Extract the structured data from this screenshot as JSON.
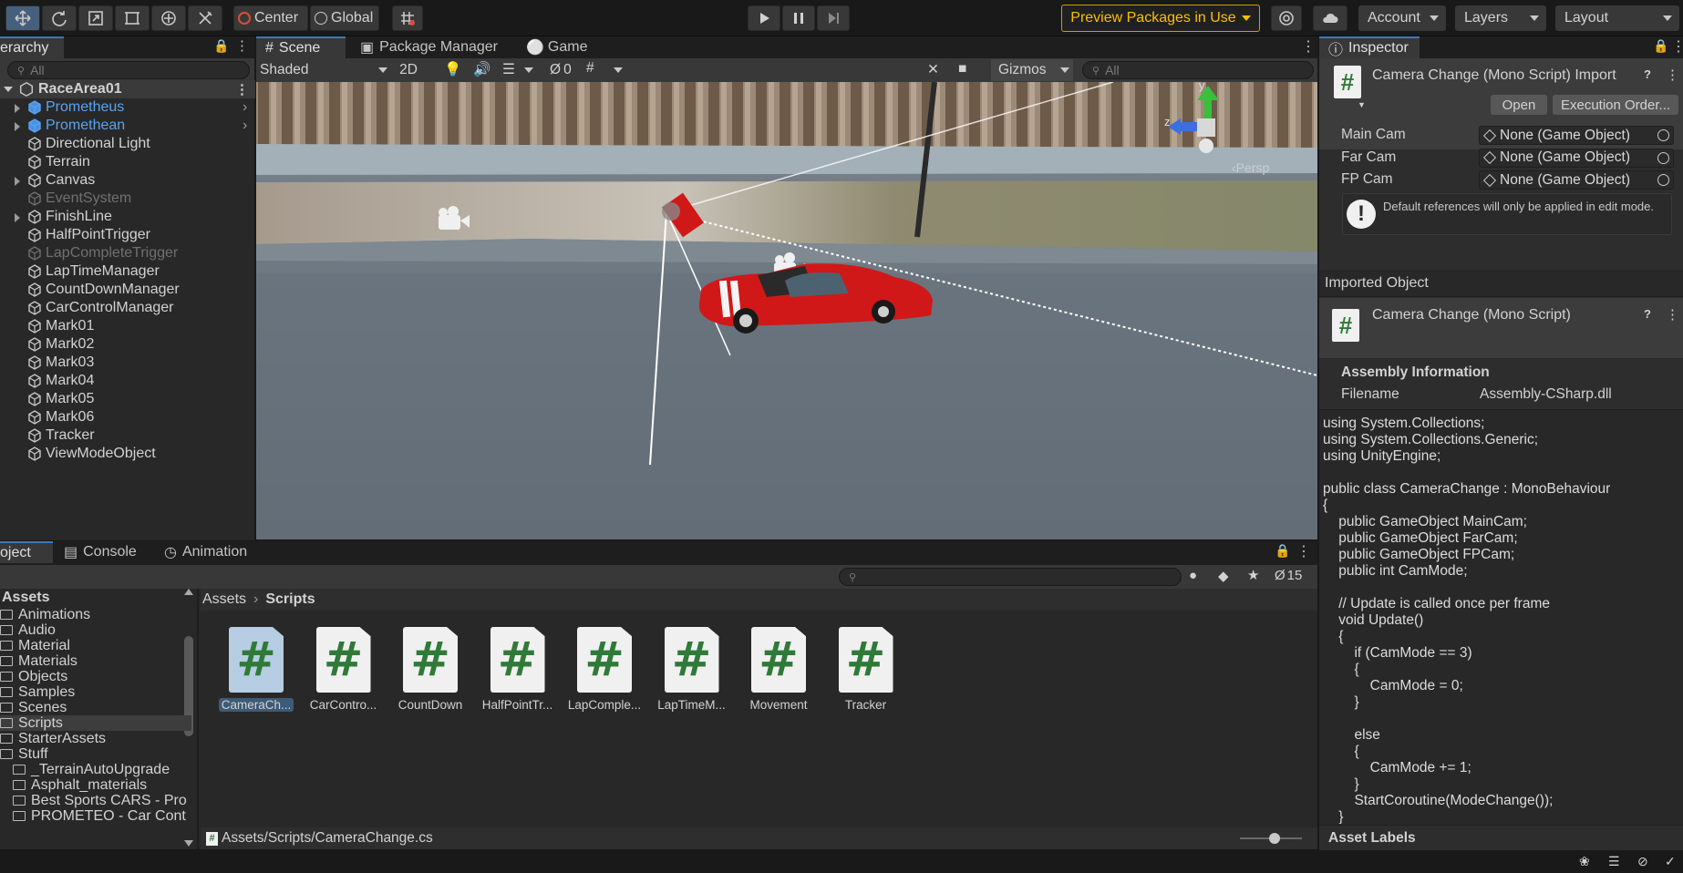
{
  "toolbar": {
    "pivot_label": "Center",
    "space_label": "Global",
    "preview_packages": "Preview Packages in Use",
    "account": "Account",
    "layers": "Layers",
    "layout": "Layout"
  },
  "hierarchy": {
    "tab": "erarchy",
    "search_placeholder": "All",
    "scene_name": "RaceArea01",
    "items": [
      {
        "label": "Prometheus",
        "style": "blue",
        "expand": true
      },
      {
        "label": "Promethean",
        "style": "blue",
        "expand": true
      },
      {
        "label": "Directional Light",
        "style": "normal",
        "expand": false
      },
      {
        "label": "Terrain",
        "style": "normal",
        "expand": false
      },
      {
        "label": "Canvas",
        "style": "normal",
        "expand": true
      },
      {
        "label": "EventSystem",
        "style": "dim",
        "expand": false
      },
      {
        "label": "FinishLine",
        "style": "normal",
        "expand": true
      },
      {
        "label": "HalfPointTrigger",
        "style": "normal",
        "expand": false
      },
      {
        "label": "LapCompleteTrigger",
        "style": "dim",
        "expand": false
      },
      {
        "label": "LapTimeManager",
        "style": "normal",
        "expand": false
      },
      {
        "label": "CountDownManager",
        "style": "normal",
        "expand": false
      },
      {
        "label": "CarControlManager",
        "style": "normal",
        "expand": false
      },
      {
        "label": "Mark01",
        "style": "normal",
        "expand": false
      },
      {
        "label": "Mark02",
        "style": "normal",
        "expand": false
      },
      {
        "label": "Mark03",
        "style": "normal",
        "expand": false
      },
      {
        "label": "Mark04",
        "style": "normal",
        "expand": false
      },
      {
        "label": "Mark05",
        "style": "normal",
        "expand": false
      },
      {
        "label": "Mark06",
        "style": "normal",
        "expand": false
      },
      {
        "label": "Tracker",
        "style": "normal",
        "expand": false
      },
      {
        "label": "ViewModeObject",
        "style": "normal",
        "expand": false
      }
    ]
  },
  "scene": {
    "tabs": [
      "Scene",
      "Package Manager",
      "Game"
    ],
    "shading_mode": "Shaded",
    "mode_2d": "2D",
    "hidden_count": "0",
    "gizmos": "Gizmos",
    "search_placeholder": "All",
    "persp_label": "Persp",
    "axis_y": "y",
    "axis_z": "z"
  },
  "project": {
    "tabs": [
      "oject",
      "Console",
      "Animation"
    ],
    "hidden_count": "15",
    "breadcrumb_root": "Assets",
    "breadcrumb_current": "Scripts",
    "tree_root": "Assets",
    "folders": [
      {
        "label": "Animations",
        "indent": 0
      },
      {
        "label": "Audio",
        "indent": 0
      },
      {
        "label": "Material",
        "indent": 0
      },
      {
        "label": "Materials",
        "indent": 0
      },
      {
        "label": "Objects",
        "indent": 0
      },
      {
        "label": "Samples",
        "indent": 0
      },
      {
        "label": "Scenes",
        "indent": 0
      },
      {
        "label": "Scripts",
        "indent": 0,
        "selected": true
      },
      {
        "label": "StarterAssets",
        "indent": 0
      },
      {
        "label": "Stuff",
        "indent": 0
      },
      {
        "label": "_TerrainAutoUpgrade",
        "indent": 1
      },
      {
        "label": "Asphalt_materials",
        "indent": 1
      },
      {
        "label": "Best Sports CARS - Pro",
        "indent": 1
      },
      {
        "label": "PROMETEO - Car Cont",
        "indent": 1
      }
    ],
    "scripts": [
      "CameraCh...",
      "CarContro...",
      "CountDown",
      "HalfPointTr...",
      "LapComple...",
      "LapTimeM...",
      "Movement",
      "Tracker"
    ],
    "selected_path": "Assets/Scripts/CameraChange.cs",
    "script_glyph": "#"
  },
  "inspector": {
    "tab": "Inspector",
    "title": "Camera Change (Mono Script) Import",
    "open_button": "Open",
    "exec_order_button": "Execution Order...",
    "fields": [
      {
        "label": "Main Cam",
        "value": "None (Game Object)"
      },
      {
        "label": "Far Cam",
        "value": "None (Game Object)"
      },
      {
        "label": "FP Cam",
        "value": "None (Game Object)"
      }
    ],
    "info_message": "Default references will only be applied in edit mode.",
    "imported_object_header": "Imported Object",
    "imported_title": "Camera Change (Mono Script)",
    "assembly_header": "Assembly Information",
    "filename_label": "Filename",
    "filename_value": "Assembly-CSharp.dll",
    "code_lines": [
      "using System.Collections;",
      "using System.Collections.Generic;",
      "using UnityEngine;",
      "",
      "public class CameraChange : MonoBehaviour",
      "{",
      "    public GameObject MainCam;",
      "    public GameObject FarCam;",
      "    public GameObject FPCam;",
      "    public int CamMode;",
      "",
      "    // Update is called once per frame",
      "    void Update()",
      "    {",
      "        if (CamMode == 3)",
      "        {",
      "            CamMode = 0;",
      "        }",
      "",
      "        else",
      "        {",
      "            CamMode += 1;",
      "        }",
      "        StartCoroutine(ModeChange());",
      "    }"
    ],
    "asset_labels": "Asset Labels"
  },
  "colors": {
    "accent": "#3a79bb",
    "preview_border": "#c9a100",
    "script_green": "#2f7a38",
    "car_red": "#d01818"
  }
}
